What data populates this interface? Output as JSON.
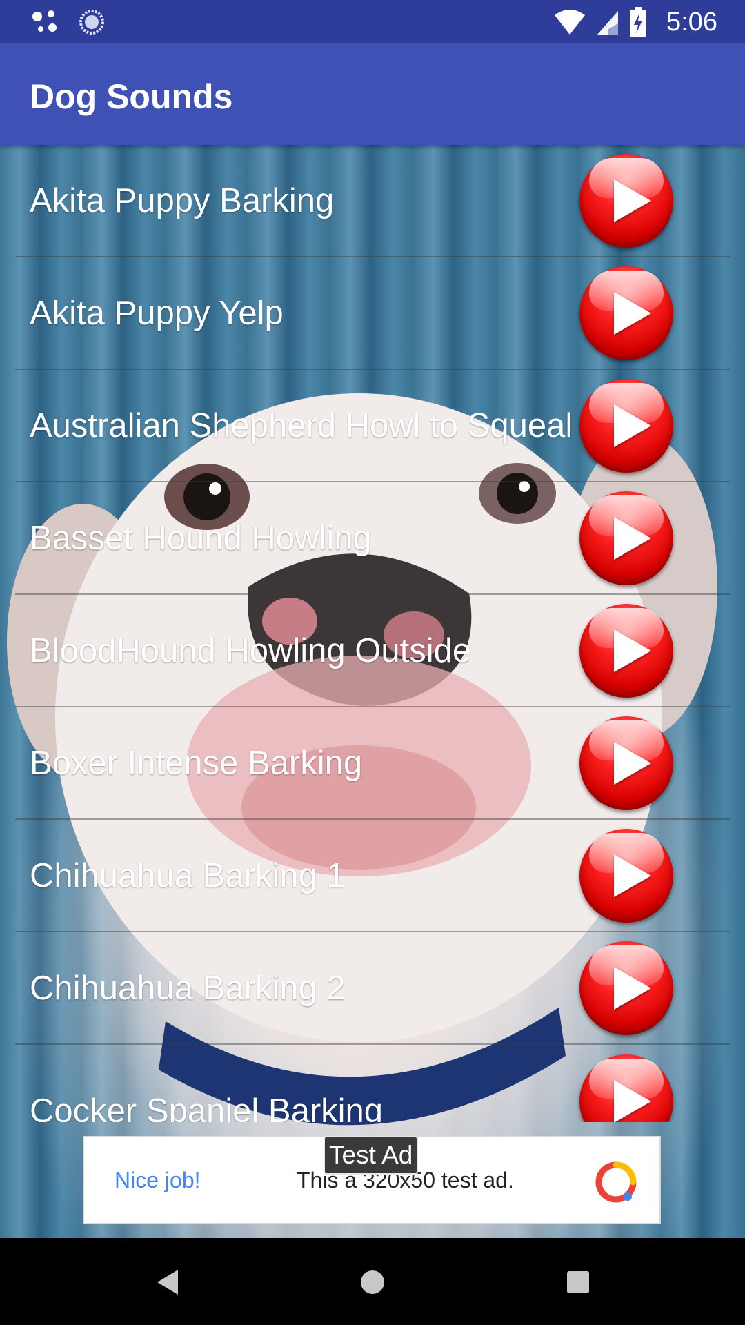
{
  "status_bar": {
    "time": "5:06",
    "icons": [
      "assistant-dots-icon",
      "sync-circle-icon",
      "wifi-icon",
      "cell-signal-icon",
      "battery-charging-icon"
    ]
  },
  "app_bar": {
    "title": "Dog Sounds",
    "color": "#3f51b5"
  },
  "sounds": [
    {
      "label": "Akita Puppy Barking"
    },
    {
      "label": "Akita Puppy Yelp"
    },
    {
      "label": "Australian Shepherd Howl to Squeal"
    },
    {
      "label": "Basset Hound Howling"
    },
    {
      "label": "BloodHound Howling Outside"
    },
    {
      "label": "Boxer Intense Barking"
    },
    {
      "label": "Chihuahua Barking 1"
    },
    {
      "label": "Chihuahua Barking 2"
    },
    {
      "label": "Cocker Spaniel Barking"
    }
  ],
  "ad": {
    "tag": "Test Ad",
    "headline": "Nice job!",
    "text": "This a 320x50 test ad."
  },
  "nav_bar": {
    "buttons": [
      "back-icon",
      "home-icon",
      "recents-icon"
    ]
  }
}
